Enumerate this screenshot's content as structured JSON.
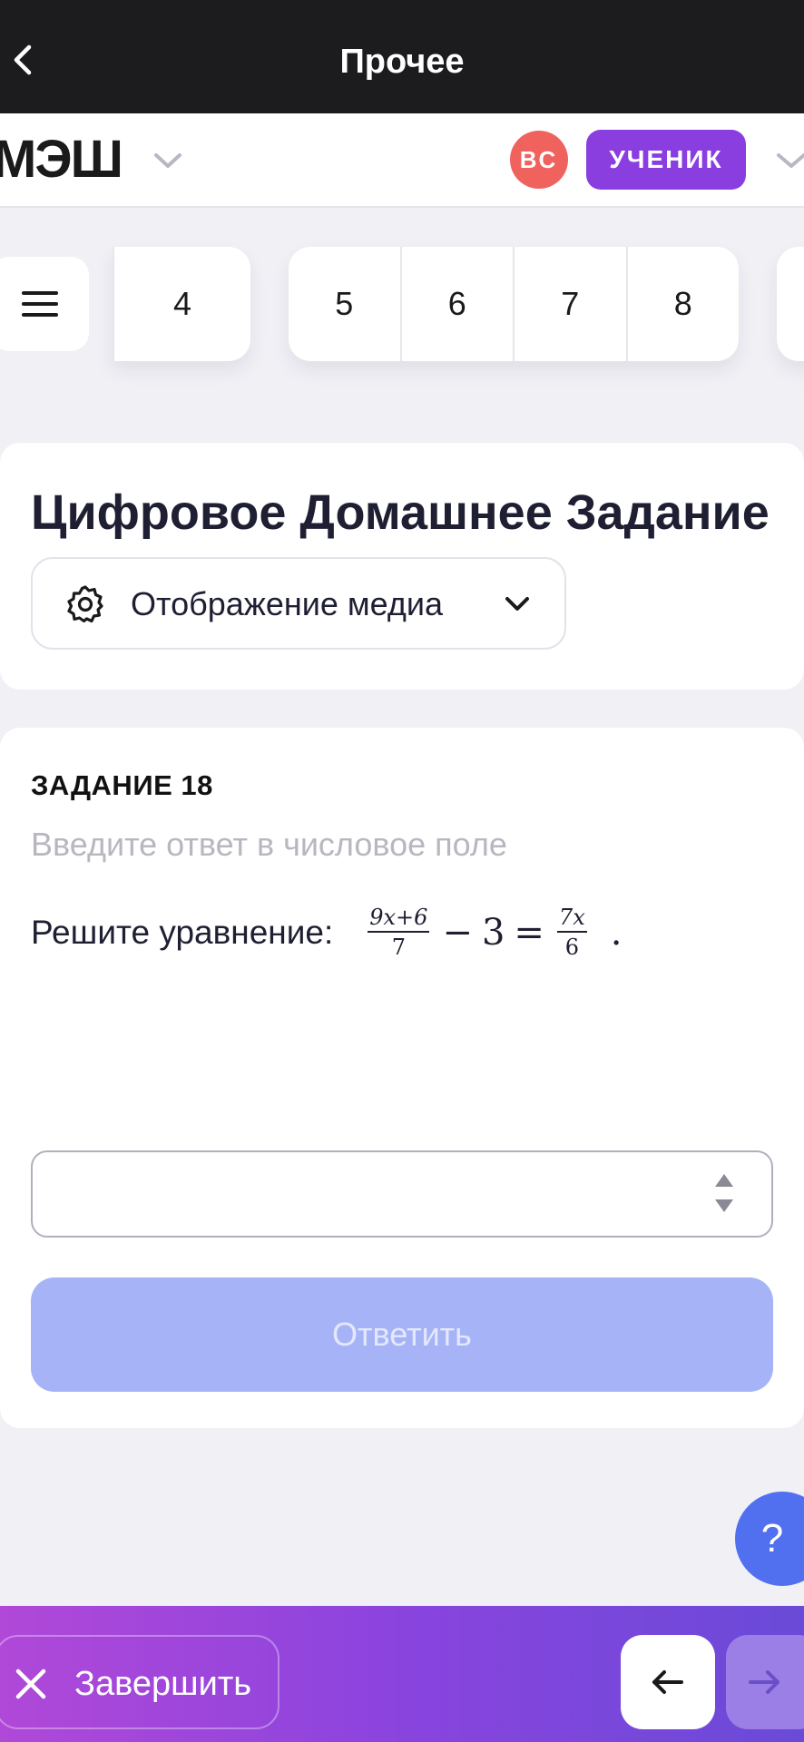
{
  "topbar": {
    "title": "Прочее"
  },
  "header": {
    "logo": "МЭШ",
    "avatar_initials": "ВС",
    "role": "УЧЕНИК"
  },
  "pagination": {
    "groups": [
      [
        "4"
      ],
      [
        "5",
        "6",
        "7",
        "8"
      ]
    ]
  },
  "title_card": {
    "heading": "Цифровое Домашнее Задание",
    "media_button": "Отображение медиа"
  },
  "task": {
    "number_label": "ЗАДАНИЕ 18",
    "hint": "Введите ответ в числовое поле",
    "question_prefix": "Решите уравнение:",
    "equation": {
      "frac1_num": "9x+6",
      "frac1_den": "7",
      "minus": "−",
      "const": "3",
      "equals": "=",
      "frac2_num": "7x",
      "frac2_den": "6",
      "end": "."
    },
    "answer_value": "",
    "submit_label": "Ответить"
  },
  "help_label": "?",
  "bottombar": {
    "finish_label": "Завершить"
  },
  "colors": {
    "topbar": "#1c1c1e",
    "role_badge": "#8a3ee0",
    "avatar": "#f0625d",
    "submit_disabled": "#a6b4f7",
    "help": "#5070f0"
  }
}
